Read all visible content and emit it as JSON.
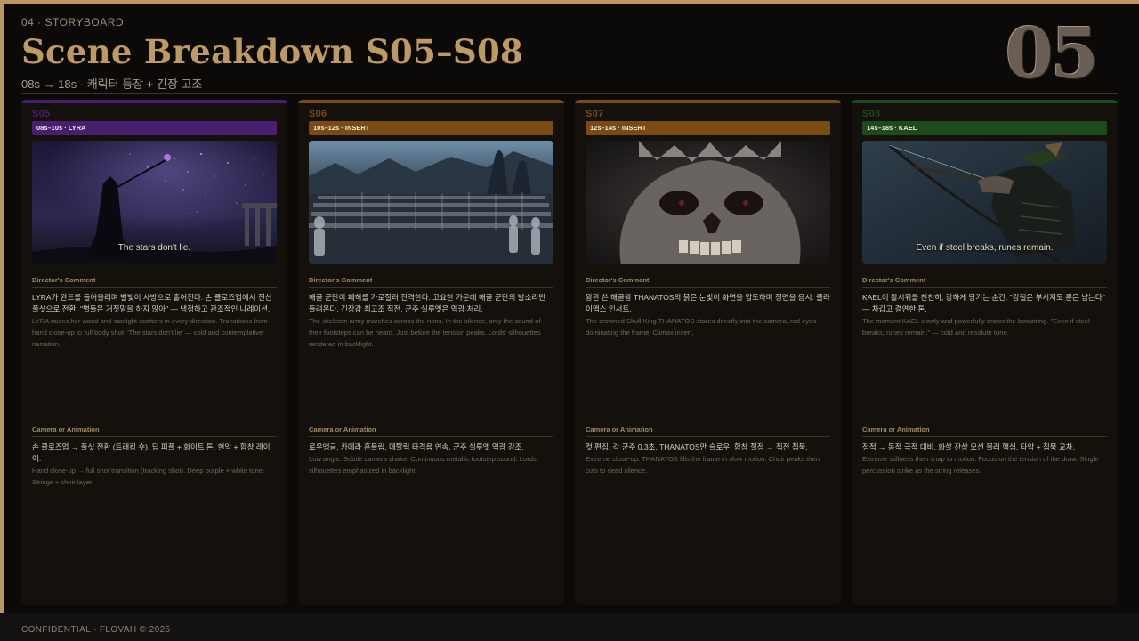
{
  "header": {
    "eyebrow": "04 · STORYBOARD",
    "title": "Scene Breakdown  S05–S08",
    "subtitle": "08s → 18s  ·  캐릭터 등장 + 긴장 고조",
    "big_number": "05"
  },
  "labels": {
    "directors_comment": "Director's Comment",
    "camera": "Camera or Animation"
  },
  "cards": [
    {
      "id": "S05",
      "tag": "08s–10s · LYRA",
      "accent": "#4a1e6e",
      "caption": "The stars don't lie.",
      "comment_ko": "LYRA가 완드를 들어올리며 별빛이 사방으로 흩어진다. 손 클로즈업에서 전신 풀샷으로 전환. \"별들은 거짓말을 하지 않아\" — 냉정하고 관조적인 나레이션.",
      "comment_en": "LYRA raises her wand and starlight scatters in every direction. Transitions from hand close-up to full body shot. 'The stars don't lie' — cold and contemplative narration.",
      "camera_ko": "손 클로즈업 → 풀샷 전환 (트래킹 숏). 딥 퍼플 + 화이트 톤. 현악 + 합창 레이어.",
      "camera_en": "Hand close-up → full shot transition (tracking shot). Deep purple + white tone. Strings + choir layer."
    },
    {
      "id": "S06",
      "tag": "10s–12s · INSERT",
      "accent": "#7a4a13",
      "caption": "",
      "comment_ko": "해골 군단이 폐허를 가로질러 진격한다. 고요한 가운데 해골 군단의 발소리만 들려온다. 긴장감 최고조 직전. 군주 실루엣은 역광 처리.",
      "comment_en": "The skeleton army marches across the ruins. In the silence, only the sound of their footsteps can be heard. Just before the tension peaks. Lords' silhouettes rendered in backlight.",
      "camera_ko": "로우앵글. 카메라 흔들림. 메탈릭 타격음 연속. 군주 실루엣 역광 강조.",
      "camera_en": "Low angle. Subtle camera shake. Continuous metallic footstep sound. Lords' silhouettes emphasized in backlight."
    },
    {
      "id": "S07",
      "tag": "12s–14s · INSERT",
      "accent": "#7a4a13",
      "caption": "",
      "comment_ko": "왕관 쓴 해골왕 THANATOS의 붉은 눈빛이 화면을 압도하며 정면을 응시. 클라이맥스 인서트.",
      "comment_en": "The crowned Skull King THANATOS stares directly into the camera, red eyes dominating the frame. Climax insert.",
      "camera_ko": "컷 편집. 각 군주 0.3초. THANATOS만 슬로우. 합창 절정 → 직전 침묵.",
      "camera_en": "Extreme close-up. THANATOS fills the frame in slow motion. Choir peaks then cuts to dead silence."
    },
    {
      "id": "S08",
      "tag": "14s–18s · KAEL",
      "accent": "#1f4a1c",
      "caption": "Even if steel breaks, runes remain.",
      "comment_ko": "KAEL이 활시위를 천천히, 강하게 당기는 순간. \"강철은 부서져도 룬은 남는다\" — 차갑고 결연한 톤.",
      "comment_en": "The moment KAEL slowly and powerfully draws the bowstring. \"Even if steel breaks, runes remain.\" — cold and resolute tone.",
      "camera_ko": "정적 → 동적 극적 대비. 화살 잔상 모션 블러 핵심. 타악 + 침묵 교차.",
      "camera_en": "Extreme stillness then snap to motion. Focus on the tension of the draw. Single percussion strike as the string releases."
    }
  ],
  "footer": "CONFIDENTIAL  ·  FLOVAH  ©  2025"
}
